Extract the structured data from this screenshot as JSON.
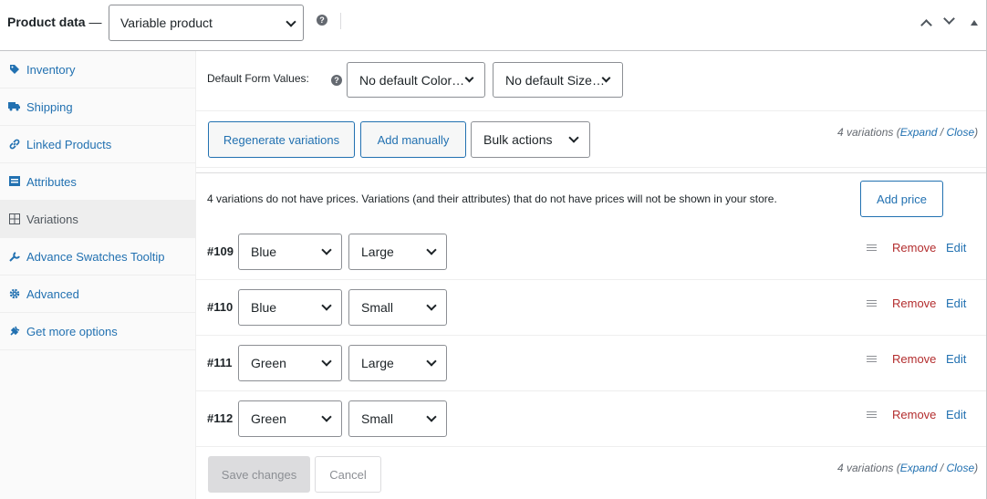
{
  "header": {
    "title": "Product data",
    "dash": "—",
    "product_type": "Variable product",
    "help_icon": "question-circle-icon",
    "controls": [
      "chevron-up-icon",
      "chevron-down-icon",
      "triangle-up-icon"
    ]
  },
  "sidebar": {
    "items": [
      {
        "label": "Inventory",
        "icon": "tag-icon"
      },
      {
        "label": "Shipping",
        "icon": "truck-icon"
      },
      {
        "label": "Linked Products",
        "icon": "link-icon"
      },
      {
        "label": "Attributes",
        "icon": "list-icon"
      },
      {
        "label": "Variations",
        "icon": "grid-icon",
        "active": true
      },
      {
        "label": "Advance Swatches Tooltip",
        "icon": "wrench-icon"
      },
      {
        "label": "Advanced",
        "icon": "gear-icon"
      },
      {
        "label": "Get more options",
        "icon": "plugin-icon"
      }
    ]
  },
  "defaults": {
    "label": "Default Form Values:",
    "color_select": "No default Color…",
    "size_select": "No default Size…"
  },
  "toolbar": {
    "regenerate": "Regenerate variations",
    "add_manually": "Add manually",
    "bulk_actions": "Bulk actions",
    "count": "4 variations",
    "expand": "Expand",
    "slash": "/",
    "close": "Close"
  },
  "notice": {
    "text": "4 variations do not have prices. Variations (and their attributes) that do not have prices will not be shown in your store.",
    "add_price": "Add price"
  },
  "variations": [
    {
      "id": "#109",
      "color": "Blue",
      "size": "Large",
      "remove": "Remove",
      "edit": "Edit"
    },
    {
      "id": "#110",
      "color": "Blue",
      "size": "Small",
      "remove": "Remove",
      "edit": "Edit"
    },
    {
      "id": "#111",
      "color": "Green",
      "size": "Large",
      "remove": "Remove",
      "edit": "Edit"
    },
    {
      "id": "#112",
      "color": "Green",
      "size": "Small",
      "remove": "Remove",
      "edit": "Edit"
    }
  ],
  "footer": {
    "save": "Save changes",
    "cancel": "Cancel",
    "count": "4 variations",
    "expand": "Expand",
    "slash": "/",
    "close": "Close"
  },
  "colors": {
    "accent": "#2271b1",
    "danger": "#b32d2e",
    "border": "#c3c4c7"
  }
}
